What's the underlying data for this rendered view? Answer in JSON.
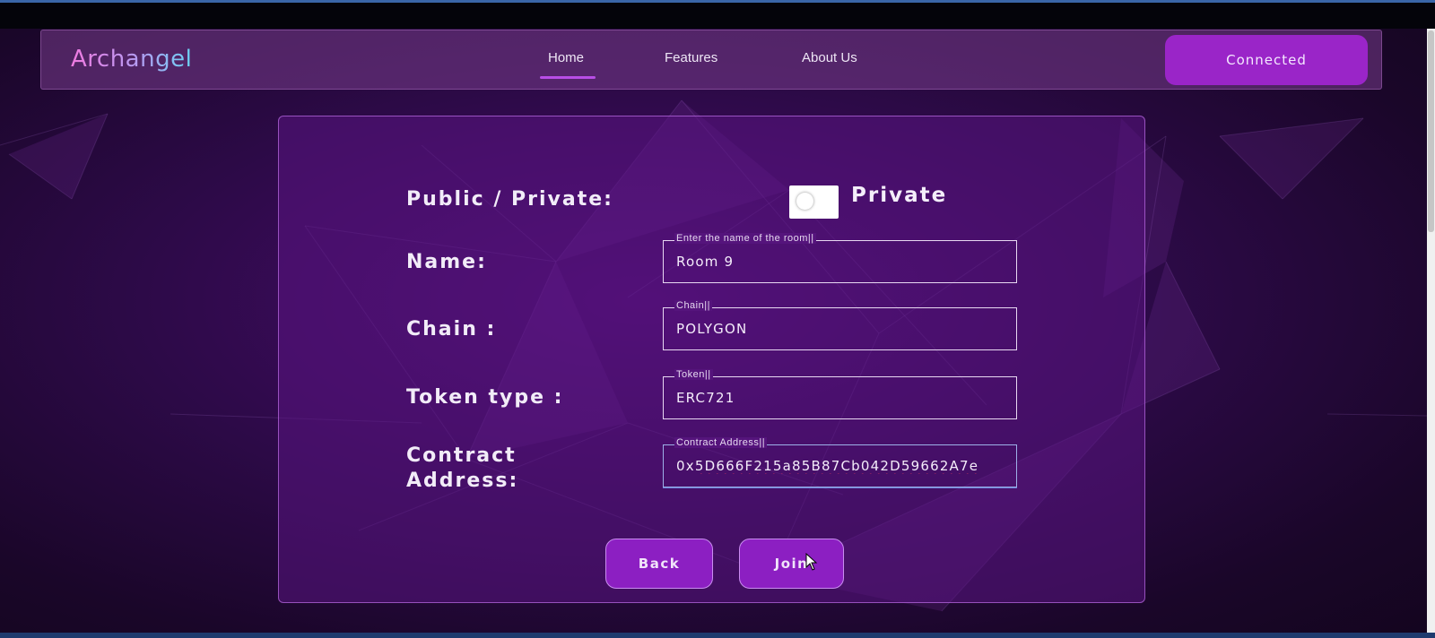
{
  "navbar": {
    "logo": "Archangel",
    "links": [
      {
        "label": "Home",
        "active": true
      },
      {
        "label": "Features",
        "active": false
      },
      {
        "label": "About Us",
        "active": false
      }
    ],
    "connect_label": "Connected"
  },
  "form": {
    "visibility": {
      "label": "Public / Private:",
      "toggle_state": "Private"
    },
    "name": {
      "label": "Name:",
      "legend": "Enter the name of the room||",
      "value": "Room 9"
    },
    "chain": {
      "label": "Chain :",
      "legend": "Chain||",
      "value": "POLYGON"
    },
    "token": {
      "label": "Token type :",
      "legend": "Token||",
      "value": "ERC721"
    },
    "contract": {
      "label_line1": "Contract",
      "label_line2": "Address:",
      "legend": "Contract Address||",
      "value_prefix": "0x",
      "value_rest": "5D666F215a85B87Cb042D59662A7e"
    },
    "buttons": {
      "back": "Back",
      "join": "Join"
    }
  },
  "colors": {
    "accent": "#9a25c8",
    "button": "#8c1fc2",
    "background": "#2d0a48"
  }
}
